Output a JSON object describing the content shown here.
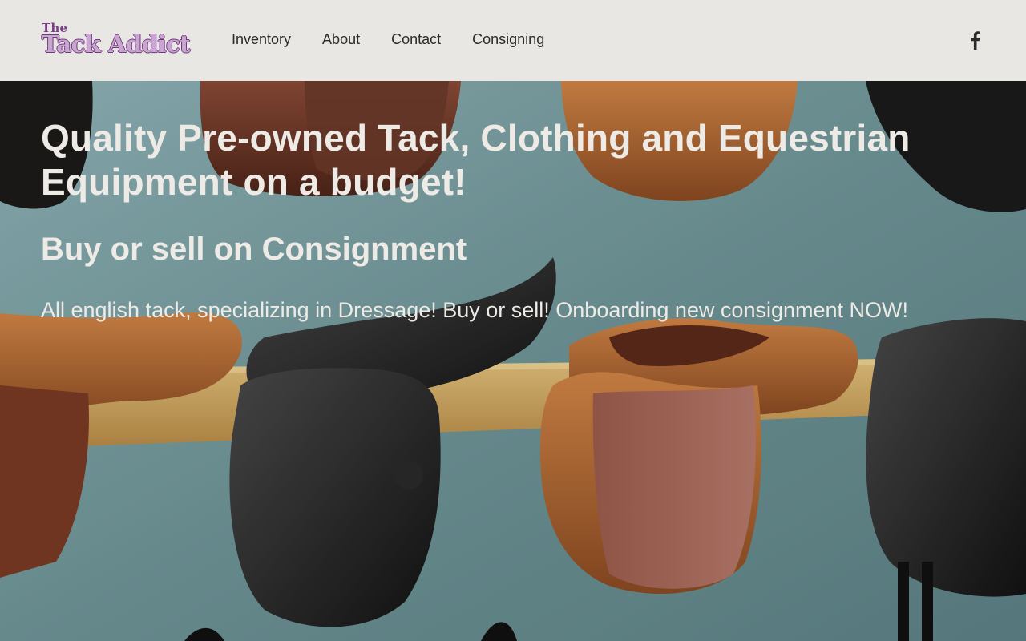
{
  "brand": {
    "the": "The",
    "name": "Tack Addict",
    "color": "#7b3f8a"
  },
  "nav": {
    "items": [
      {
        "label": "Inventory"
      },
      {
        "label": "About"
      },
      {
        "label": "Contact"
      },
      {
        "label": "Consigning"
      }
    ]
  },
  "social": {
    "icon": "facebook-icon"
  },
  "hero": {
    "headline": "Quality Pre-owned Tack, Clothing and Equestrian Equipment  on a budget!",
    "subheadline": "Buy or sell on Consignment",
    "tagline": "All english tack, specializing in Dressage! Buy or sell! Onboarding new consignment NOW!",
    "image": "saddles-on-wall-rack",
    "text_color": "#eeebe6"
  }
}
